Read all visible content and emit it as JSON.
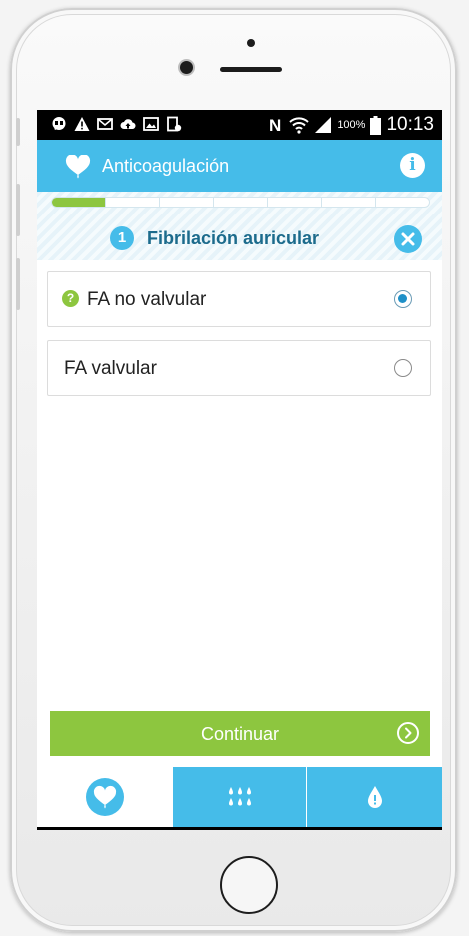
{
  "status_bar": {
    "battery_percent": "100%",
    "time": "10:13",
    "left_icons": [
      "chat-icon",
      "warning-icon",
      "mail-icon",
      "cloud-upload-icon",
      "image-icon",
      "screenshot-icon"
    ],
    "right_icons": [
      "nfc-icon",
      "wifi-icon",
      "signal-icon",
      "battery-icon"
    ]
  },
  "app_bar": {
    "title": "Anticoagulación",
    "logo_icon": "heart-drop-icon",
    "info_icon": "info-icon"
  },
  "progress": {
    "total_steps": 7,
    "completed_steps": 1
  },
  "step": {
    "number": "1",
    "title": "Fibrilación auricular",
    "close_icon": "close-icon"
  },
  "options": [
    {
      "label": "FA no valvular",
      "selected": true,
      "help_icon": "question-icon"
    },
    {
      "label": "FA valvular",
      "selected": false
    }
  ],
  "continue_button": {
    "label": "Continuar",
    "icon": "chevron-right-circle-icon"
  },
  "tabs": [
    {
      "icon": "heart-drop-icon",
      "active": true
    },
    {
      "icon": "drops-grid-icon",
      "active": false
    },
    {
      "icon": "drop-alert-icon",
      "active": false
    }
  ],
  "colors": {
    "primary": "#45bce9",
    "accent_green": "#8dc63f",
    "step_title": "#1c6b8c"
  }
}
